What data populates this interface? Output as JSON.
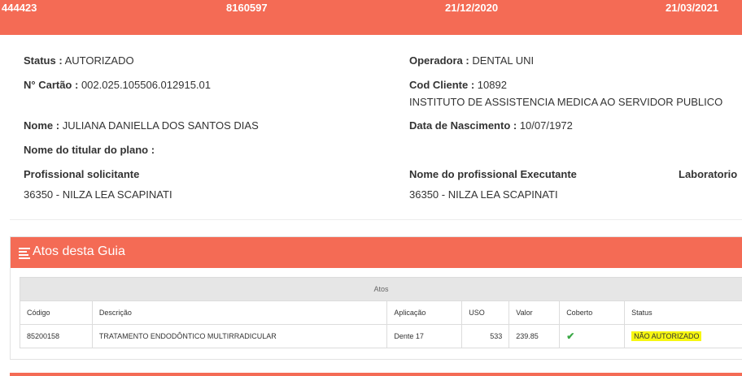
{
  "summary": {
    "guide_number": "444423",
    "card_code": "8160597",
    "issue_date": "21/12/2020",
    "expiry_date": "21/03/2021"
  },
  "details": {
    "status": {
      "label": "Status :",
      "value": "AUTORIZADO"
    },
    "operadora": {
      "label": "Operadora :",
      "value": "DENTAL UNI"
    },
    "cartao": {
      "label": "N° Cartão :",
      "value": "002.025.105506.012915.01"
    },
    "cod_cliente": {
      "label": "Cod Cliente :",
      "value": "10892",
      "extra": "INSTITUTO DE ASSISTENCIA MEDICA AO SERVIDOR PUBLICO"
    },
    "nome": {
      "label": "Nome :",
      "value": "JULIANA DANIELLA DOS SANTOS DIAS"
    },
    "nascimento": {
      "label": "Data de Nascimento :",
      "value": "10/07/1972"
    },
    "titular": {
      "label": "Nome do titular do plano :",
      "value": ""
    },
    "solicitante": {
      "label": "Profissional solicitante",
      "value": "36350 - NILZA LEA SCAPINATI"
    },
    "executante": {
      "label": "Nome do profissional Executante",
      "value": "36350 - NILZA LEA SCAPINATI"
    },
    "laboratorio": {
      "label": "Laboratorio"
    }
  },
  "atos": {
    "title": "Atos desta Guia",
    "group_header": "Atos",
    "columns": [
      "Código",
      "Descrição",
      "Aplicação",
      "USO",
      "Valor",
      "Coberto",
      "Status"
    ],
    "rows": [
      {
        "codigo": "85200158",
        "descricao": "TRATAMENTO ENDODÔNTICO MULTIRRADICULAR",
        "aplicacao": "Dente 17",
        "uso": "533",
        "valor": "239.85",
        "coberto_icon": "check-icon",
        "status": "NÃO AUTORIZADO"
      }
    ]
  },
  "colors": {
    "accent": "#f46b55",
    "highlight": "#f7f711",
    "check": "#3aa845"
  }
}
